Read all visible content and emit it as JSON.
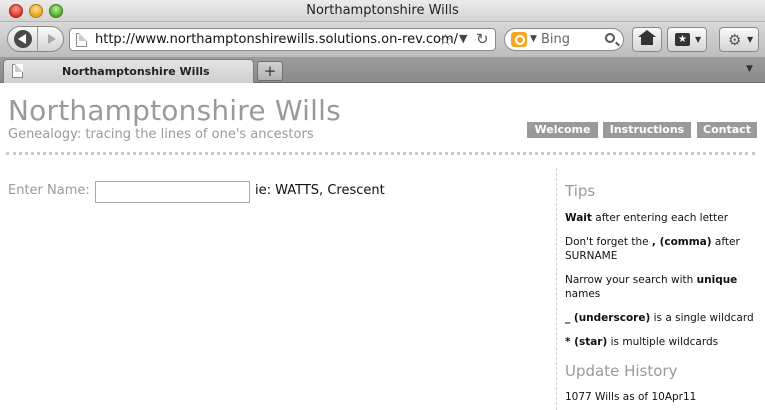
{
  "window": {
    "title": "Northamptonshire Wills"
  },
  "toolbar": {
    "url": "http://www.northamptonshirewills.solutions.on-rev.com/",
    "search_engine": "Bing",
    "icons": [
      "back-icon",
      "forward-icon",
      "page-icon",
      "star-icon",
      "reload-icon",
      "bing-icon",
      "search-icon",
      "home-icon",
      "bookmarks-icon",
      "tools-icon"
    ]
  },
  "tabs": [
    {
      "label": "Northamptonshire Wills",
      "active": true
    }
  ],
  "newtab_label": "+",
  "site": {
    "title": "Northamptonshire Wills",
    "subtitle": "Genealogy: tracing the lines of one's ancestors",
    "nav": [
      {
        "label": "Welcome"
      },
      {
        "label": "Instructions"
      },
      {
        "label": "Contact"
      }
    ]
  },
  "search": {
    "label": "Enter Name:",
    "value": "",
    "example": "ie: WATTS, Crescent"
  },
  "sidebar": {
    "tips_heading": "Tips",
    "tips": [
      {
        "bold": "Wait",
        "text": " after entering each letter"
      },
      {
        "pre": "Don't forget the ",
        "bold": ", (comma)",
        "text": " after SURNAME"
      },
      {
        "pre": "Narrow your search with ",
        "bold": "unique",
        "text": " names"
      },
      {
        "bold": "_ (underscore)",
        "text": " is a single wildcard"
      },
      {
        "bold": "* (star)",
        "text": " is multiple wildcards"
      }
    ],
    "history_heading": "Update History",
    "history_text": "1077 Wills as of 10Apr11"
  },
  "colors": {
    "heading_gray": "#9a9a9a",
    "nav_button_bg": "#9a9a9a",
    "nav_button_text": "#ffffff"
  }
}
